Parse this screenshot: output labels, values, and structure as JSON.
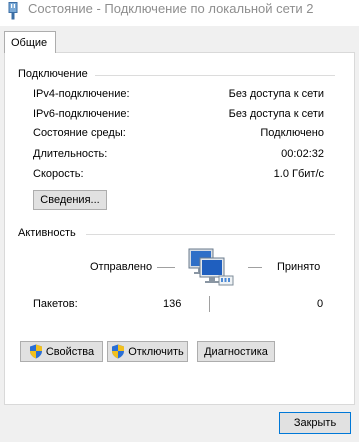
{
  "window": {
    "title": "Состояние - Подключение по локальной сети 2"
  },
  "tabs": [
    {
      "label": "Общие"
    }
  ],
  "connection": {
    "heading": "Подключение",
    "rows": [
      {
        "label": "IPv4-подключение:",
        "value": "Без доступа к сети"
      },
      {
        "label": "IPv6-подключение:",
        "value": "Без доступа к сети"
      },
      {
        "label": "Состояние среды:",
        "value": "Подключено"
      },
      {
        "label": "Длительность:",
        "value": "00:02:32"
      },
      {
        "label": "Скорость:",
        "value": "1.0 Гбит/с"
      }
    ],
    "details_button": "Сведения..."
  },
  "activity": {
    "heading": "Активность",
    "sent_label": "Отправлено",
    "received_label": "Принято",
    "packets_label": "Пакетов:",
    "packets_sent": "136",
    "packets_received": "0"
  },
  "buttons": {
    "properties": "Свойства",
    "disable": "Отключить",
    "diagnose": "Диагностика",
    "close": "Закрыть"
  },
  "icons": {
    "title": "network-adapter-icon",
    "computers": "network-computers-icon",
    "shield": "uac-shield-icon"
  },
  "colors": {
    "background": "#f0f0f0",
    "panel": "#ffffff",
    "title_text": "#8e8e8e",
    "button": "#e1e1e1",
    "button_border": "#adadad",
    "close_button_border": "#0078d7"
  }
}
